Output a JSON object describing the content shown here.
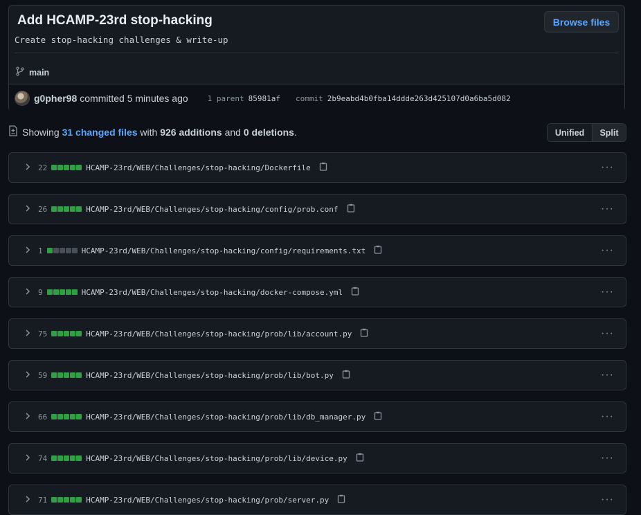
{
  "commit": {
    "title": "Add HCAMP-23rd stop-hacking",
    "description": "Create stop-hacking challenges & write-up",
    "browse_label": "Browse files",
    "branch": "main",
    "author": "g0pher98",
    "committed_text": "committed 5 minutes ago",
    "parent_label": "1 parent",
    "parent_sha": "85981af",
    "commit_label": "commit",
    "commit_sha": "2b9eabd4b0fba14ddde263d425107d0a6ba5d082"
  },
  "summary": {
    "showing": "Showing",
    "changed_files": "31 changed files",
    "with": "with",
    "additions": "926 additions",
    "and": "and",
    "deletions": "0 deletions",
    "period": "."
  },
  "view_toggle": {
    "unified": "Unified",
    "split": "Split",
    "selected": "Unified"
  },
  "colors": {
    "added": "#2ea043",
    "neutral": "#484f58",
    "link": "#58a6ff"
  },
  "files": [
    {
      "count": "22",
      "name": "HCAMP-23rd/WEB/Challenges/stop-hacking/Dockerfile",
      "green_blocks": 5
    },
    {
      "count": "26",
      "name": "HCAMP-23rd/WEB/Challenges/stop-hacking/config/prob.conf",
      "green_blocks": 5
    },
    {
      "count": "1",
      "name": "HCAMP-23rd/WEB/Challenges/stop-hacking/config/requirements.txt",
      "green_blocks": 1
    },
    {
      "count": "9",
      "name": "HCAMP-23rd/WEB/Challenges/stop-hacking/docker-compose.yml",
      "green_blocks": 5
    },
    {
      "count": "75",
      "name": "HCAMP-23rd/WEB/Challenges/stop-hacking/prob/lib/account.py",
      "green_blocks": 5
    },
    {
      "count": "59",
      "name": "HCAMP-23rd/WEB/Challenges/stop-hacking/prob/lib/bot.py",
      "green_blocks": 5
    },
    {
      "count": "66",
      "name": "HCAMP-23rd/WEB/Challenges/stop-hacking/prob/lib/db_manager.py",
      "green_blocks": 5
    },
    {
      "count": "74",
      "name": "HCAMP-23rd/WEB/Challenges/stop-hacking/prob/lib/device.py",
      "green_blocks": 5
    },
    {
      "count": "71",
      "name": "HCAMP-23rd/WEB/Challenges/stop-hacking/prob/server.py",
      "green_blocks": 5
    }
  ]
}
